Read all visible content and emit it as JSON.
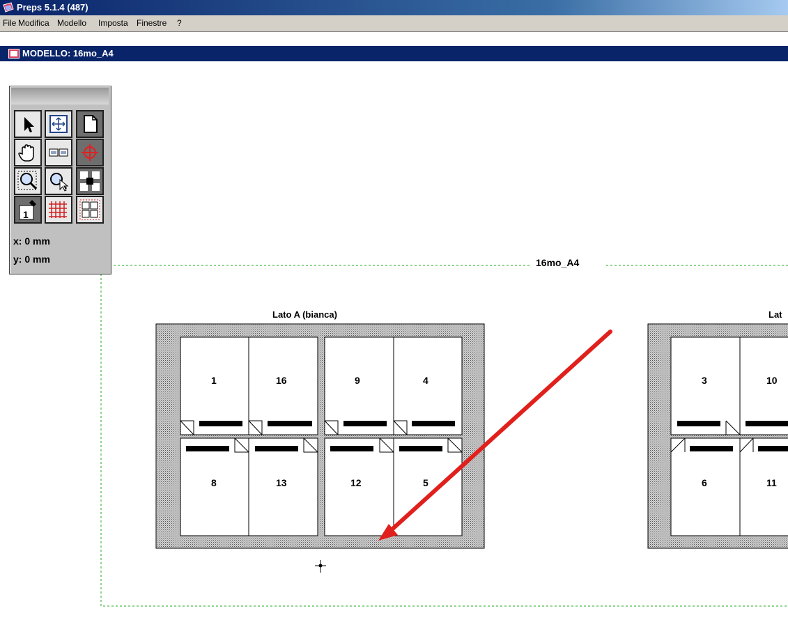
{
  "window": {
    "title": "Preps 5.1.4 (487)"
  },
  "menu": {
    "items": [
      "File",
      "Modifica",
      "Modello",
      "Imposta",
      "Finestre",
      "?"
    ]
  },
  "document": {
    "title": "MODELLO: 16mo_A4"
  },
  "palette": {
    "x_readout": "x: 0 mm",
    "y_readout": "y: 0 mm"
  },
  "layout": {
    "template_name": "16mo_A4",
    "side_a_label": "Lato A (bianca)",
    "side_b_label_visible": "Lat",
    "side_a_pages": {
      "top": [
        "1",
        "16",
        "9",
        "4"
      ],
      "bottom": [
        "8",
        "13",
        "12",
        "5"
      ]
    },
    "side_b_pages": {
      "top": [
        "3",
        "10"
      ],
      "bottom": [
        "6",
        "11"
      ]
    }
  },
  "colors": {
    "annotation_arrow": "#e0201c",
    "guide": "#22aa22",
    "titlebar": "#0a246a"
  }
}
